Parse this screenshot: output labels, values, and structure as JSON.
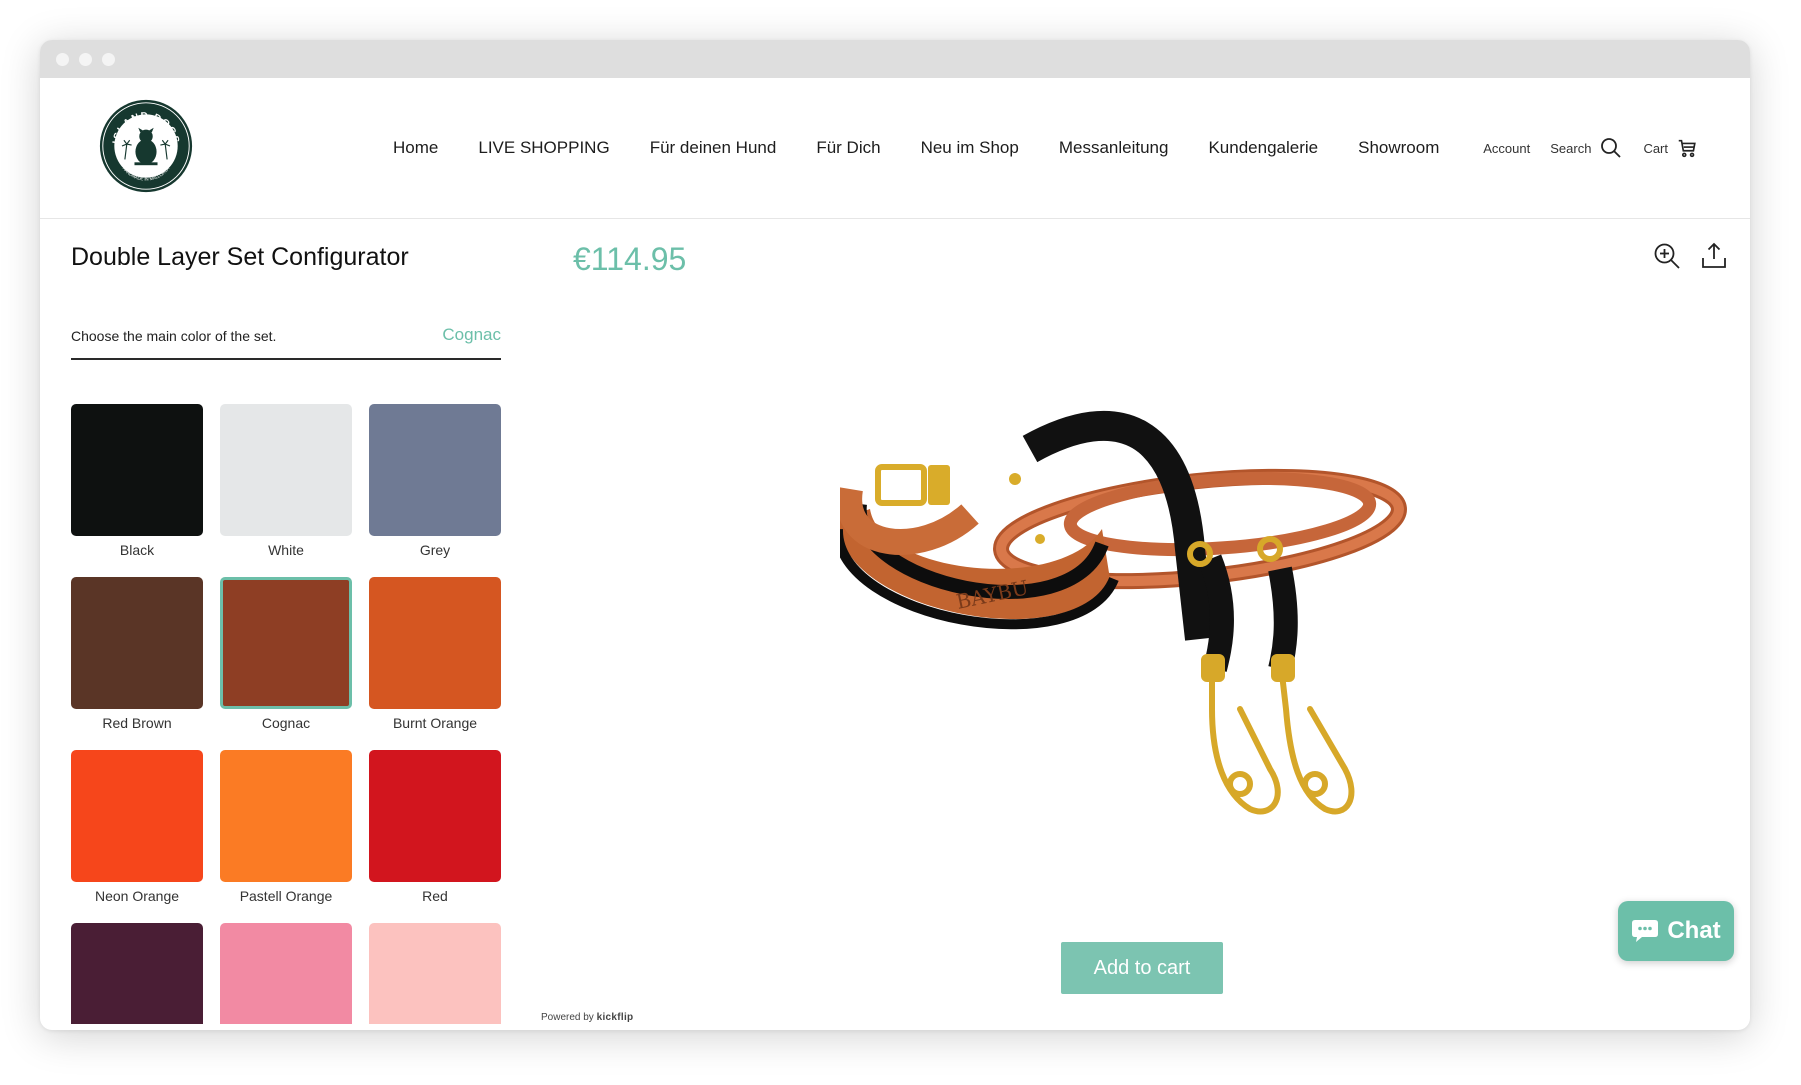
{
  "colors": {
    "accent": "#6cbfa9"
  },
  "header": {
    "logo_top": "ISLAND DOGS",
    "logo_bottom": "HANDMADE IN MALLORCA",
    "nav": [
      {
        "label": "Home"
      },
      {
        "label": "LIVE SHOPPING"
      },
      {
        "label": "Für deinen Hund"
      },
      {
        "label": "Für Dich"
      },
      {
        "label": "Neu im Shop"
      },
      {
        "label": "Messanleitung"
      },
      {
        "label": "Kundengalerie"
      },
      {
        "label": "Showroom"
      }
    ],
    "account_label": "Account",
    "search_label": "Search",
    "cart_label": "Cart"
  },
  "product": {
    "title": "Double Layer Set Configurator",
    "price": "€114.95",
    "image_engraving": "BAYBU"
  },
  "option": {
    "label": "Choose the main color of the set.",
    "selected_value": "Cognac"
  },
  "swatches": [
    {
      "name": "Black",
      "color": "#0e1110"
    },
    {
      "name": "White",
      "color": "#e5e7e8"
    },
    {
      "name": "Grey",
      "color": "#6f7a94"
    },
    {
      "name": "Red Brown",
      "color": "#5a3526"
    },
    {
      "name": "Cognac",
      "color": "#8e3e24",
      "selected": true
    },
    {
      "name": "Burnt Orange",
      "color": "#d55621"
    },
    {
      "name": "Neon Orange",
      "color": "#f6461b"
    },
    {
      "name": "Pastell Orange",
      "color": "#fb7b24"
    },
    {
      "name": "Red",
      "color": "#d2151e"
    },
    {
      "name": "",
      "color": "#4a1e35"
    },
    {
      "name": "",
      "color": "#f28aa3"
    },
    {
      "name": "",
      "color": "#fcc2bf"
    }
  ],
  "footer": {
    "powered_prefix": "Powered by",
    "powered_brand": "kickflip"
  },
  "actions": {
    "add_to_cart": "Add to cart",
    "chat_label": "Chat"
  }
}
